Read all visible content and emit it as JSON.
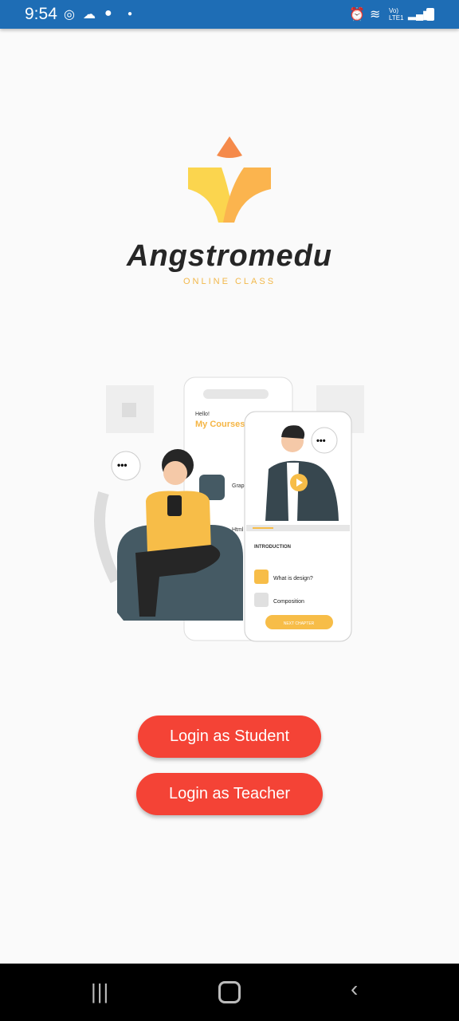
{
  "status_bar": {
    "time": "9:54",
    "network": "Vo) LTE1",
    "left_icons": [
      "instagram-icon",
      "cloud-icon",
      "app-icon",
      "dot-icon"
    ],
    "right_icons": [
      "alarm-icon",
      "wifi-icon",
      "signal-icon",
      "battery-icon"
    ]
  },
  "logo": {
    "brand": "Angstromedu",
    "tagline": "ONLINE CLASS",
    "colors": {
      "top": "#f58a4a",
      "left": "#fbd54e",
      "right": "#fbb44e"
    }
  },
  "illustration": {
    "greeting": "Hello!",
    "heading": "My Courses",
    "list": [
      "Graphic",
      "Html"
    ],
    "section": "INTRODUCTION",
    "chapters": [
      "What is design?",
      "Composition"
    ],
    "next_button": "NEXT CHAPTER"
  },
  "actions": {
    "student": "Login as Student",
    "teacher": "Login as Teacher",
    "color": "#f44336"
  },
  "nav": {
    "recent": "recent-apps-icon",
    "home": "home-icon",
    "back": "back-icon"
  }
}
